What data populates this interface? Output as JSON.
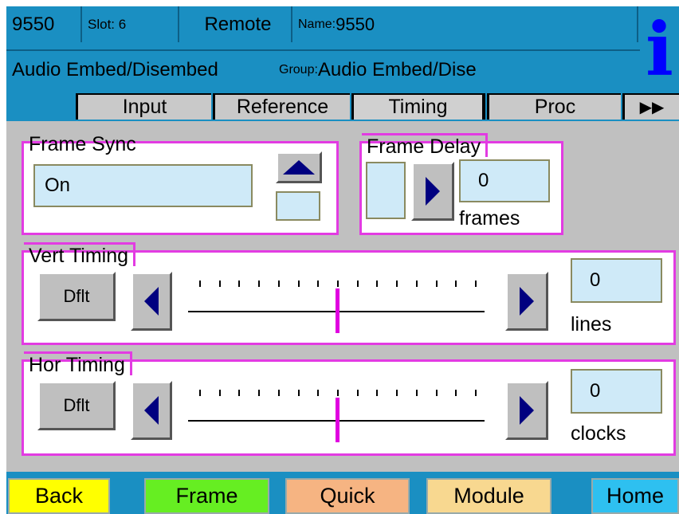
{
  "header": {
    "model": "9550",
    "slot_label": "Slot: 6",
    "mode": "Remote",
    "name_label": "Name:",
    "name_value": "9550",
    "module_type": "Audio Embed/Disembed",
    "group_label": "Group:",
    "group_value": "Audio Embed/Dise",
    "info_glyph": "i"
  },
  "tabs": [
    {
      "label": "Input"
    },
    {
      "label": "Reference"
    },
    {
      "label": "Timing"
    },
    {
      "label": "Proc"
    },
    {
      "label": "▶▶"
    }
  ],
  "frame_sync": {
    "legend": "Frame Sync",
    "value": "On",
    "up_icon": "up-triangle-icon"
  },
  "frame_delay": {
    "legend": "Frame Delay",
    "value": "0",
    "unit": "frames"
  },
  "vert_timing": {
    "legend": "Vert Timing",
    "default_label": "Dflt",
    "value": "0",
    "unit": "lines",
    "slider_level": 0.5
  },
  "hor_timing": {
    "legend": "Hor Timing",
    "default_label": "Dflt",
    "value": "0",
    "unit": "clocks",
    "slider_level": 0.5
  },
  "nav": {
    "back": "Back",
    "frame": "Frame",
    "quick": "Quick",
    "module": "Module",
    "home": "Home"
  },
  "colors": {
    "header_bg": "#1a8fc2",
    "panel_bg": "#c0c0c0",
    "group_border": "#e23be2",
    "field_bg": "#cfeaf8",
    "slider_thumb": "#e000e0",
    "back": "#ffff00",
    "frame": "#66ee22",
    "quick": "#f6b482",
    "module": "#f8d890",
    "home": "#2ec0f0",
    "info": "#0000ff"
  }
}
